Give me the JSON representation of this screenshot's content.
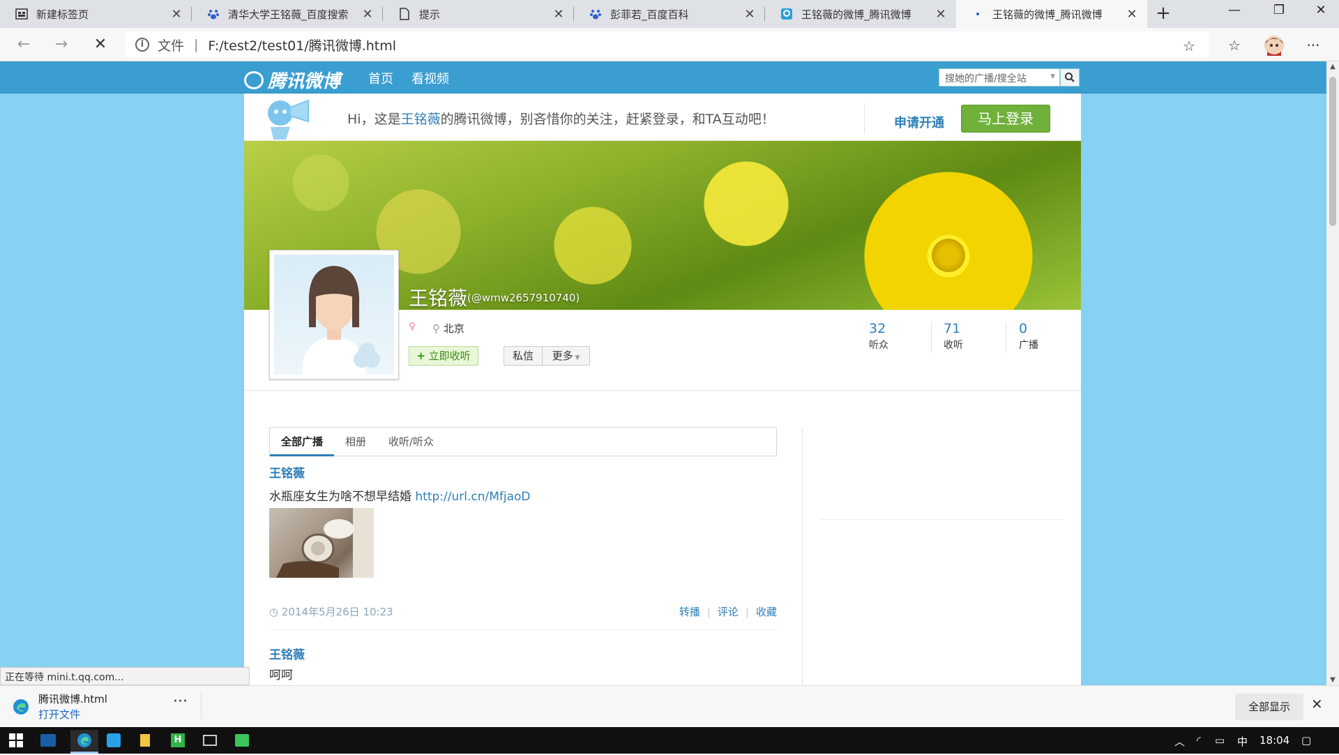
{
  "browser": {
    "tabs": [
      {
        "title": "新建标签页"
      },
      {
        "title": "清华大学王铭薇_百度搜索"
      },
      {
        "title": "提示"
      },
      {
        "title": "彭菲若_百度百科"
      },
      {
        "title": "王铭薇的微博_腾讯微博"
      },
      {
        "title": "王铭薇的微博_腾讯微博"
      }
    ],
    "new_tab": "+",
    "address": {
      "scheme": "文件",
      "divider": "|",
      "url": "F:/test2/test01/腾讯微博.html"
    }
  },
  "site": {
    "logo": "腾讯微博",
    "nav": [
      "首页",
      "看视频"
    ],
    "search_placeholder": "搜她的广播/搜全站"
  },
  "welcome": {
    "prefix": "Hi，这是",
    "name": "王铭薇",
    "suffix": "的腾讯微博，别吝惜你的关注，赶紧登录，和TA互动吧！",
    "apply": "申请开通",
    "login": "马上登录"
  },
  "profile": {
    "name": "王铭薇",
    "handle": "(@wmw2657910740)",
    "location": "北京",
    "follow": "立即收听",
    "message": "私信",
    "more": "更多",
    "stats": [
      {
        "num": "32",
        "label": "听众"
      },
      {
        "num": "71",
        "label": "收听"
      },
      {
        "num": "0",
        "label": "广播"
      }
    ]
  },
  "feed_tabs": [
    "全部广播",
    "相册",
    "收听/听众"
  ],
  "posts": [
    {
      "author": "王铭薇",
      "text": "水瓶座女生为啥不想早结婚",
      "link": "http://url.cn/MfjaoD",
      "time": "2014年5月26日 10:23",
      "actions": [
        "转播",
        "评论",
        "收藏"
      ]
    },
    {
      "author": "王铭薇",
      "text": "呵呵"
    }
  ],
  "status_text": "正在等待 mini.t.qq.com...",
  "download": {
    "name": "腾讯微博.html",
    "open": "打开文件",
    "show_all": "全部显示"
  },
  "taskbar": {
    "ime": "中",
    "clock": "18:04"
  },
  "colors": {
    "nav": "#3a9ed1",
    "page_bg": "#87d1f3",
    "link": "#2e7fb8",
    "login": "#6fb13a"
  }
}
